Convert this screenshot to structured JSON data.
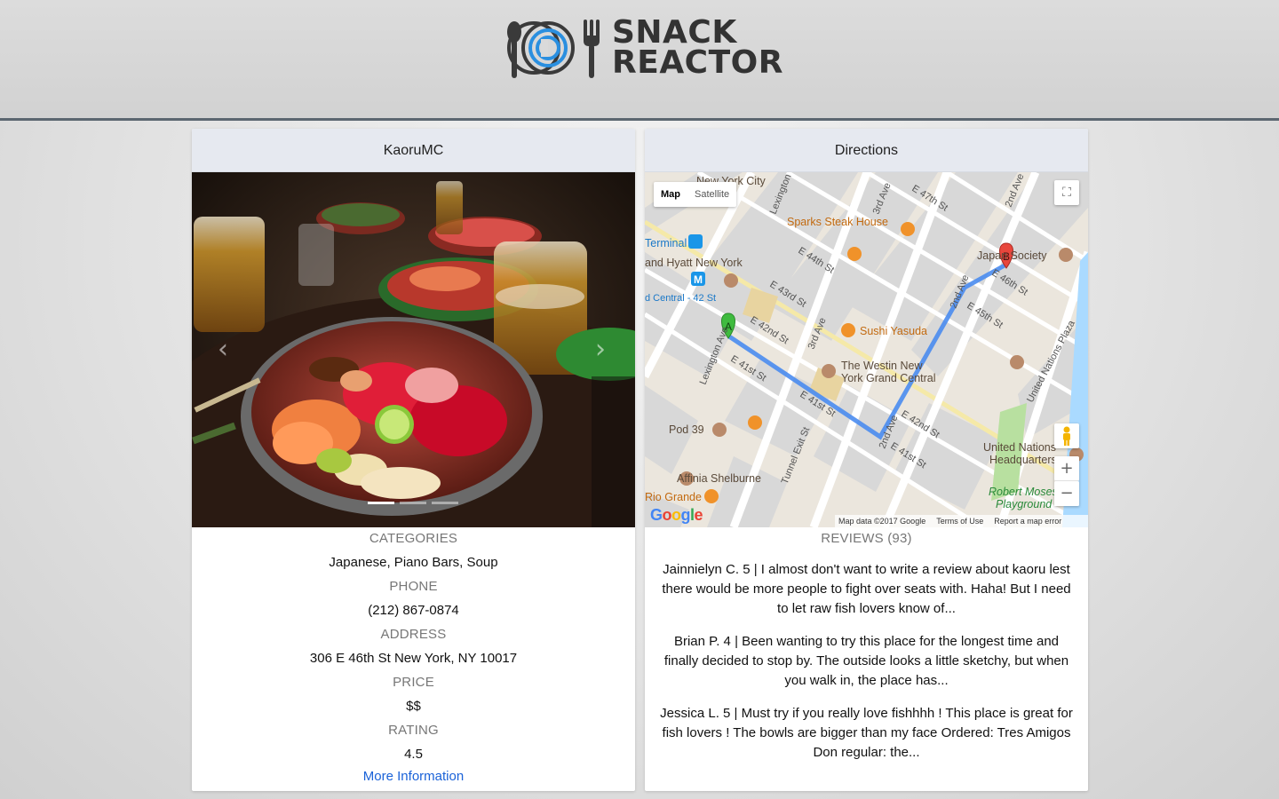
{
  "brand": {
    "line1": "SNACK",
    "line2": "REACTOR",
    "accent_color": "#2a8fe0",
    "icon_color": "#3a3a3a"
  },
  "restaurant": {
    "name": "KaoruMC",
    "categories_label": "CATEGORIES",
    "categories": "Japanese, Piano Bars, Soup",
    "phone_label": "PHONE",
    "phone": "(212) 867-0874",
    "address_label": "ADDRESS",
    "address": "306 E 46th St New York, NY 10017",
    "price_label": "PRICE",
    "price": "$$",
    "rating_label": "RATING",
    "rating": "4.5",
    "more_info": "More Information"
  },
  "carousel": {
    "prev_icon": "chevron-left-icon",
    "next_icon": "chevron-right-icon",
    "slide_count": 3,
    "active_slide": 1
  },
  "directions": {
    "title": "Directions",
    "map_type": {
      "map": "Map",
      "satellite": "Satellite",
      "selected": "Map"
    },
    "google": "Google",
    "footer": {
      "data": "Map data ©2017 Google",
      "terms": "Terms of Use",
      "report": "Report a map error"
    },
    "zoom_in": "+",
    "zoom_out": "−",
    "markers": {
      "a": "A",
      "b": "B"
    },
    "route_color": "#4a8cf0",
    "labels": {
      "nyc": "New York City",
      "lexington": "Lexington",
      "third_ave": "3rd Ave",
      "e47": "E 47th St",
      "sparks": "Sparks Steak House",
      "terminal": "Terminal",
      "hyatt": "and Hyatt New York",
      "e44": "E 44th St",
      "central42": "d Central - 42 St",
      "e43": "E 43rd St",
      "e42a": "E 42nd St",
      "sushi": "Sushi Yasuda",
      "third_ave2": "3rd Ave",
      "lex2": "Lexington Ave",
      "e41a": "E 41st St",
      "westin1": "The Westin New",
      "westin2": "York Grand Central",
      "e41b": "E 41st St",
      "pod39": "Pod 39",
      "tunnel": "Tunnel Exit St",
      "second_ave": "2nd Ave",
      "e41c": "E 41st St",
      "e42b": "E 42nd St",
      "e45": "E 45th St",
      "e46": "E 46th St",
      "japan": "Japan Society",
      "second_ave2": "2nd Ave",
      "second_ave3": "2nd Ave",
      "un_plaza": "United Nations Plaza",
      "un1": "United Nations",
      "un2": "Headquarters",
      "moses1": "Robert Moses",
      "moses2": "Playground",
      "affinia": "Affinia Shelburne",
      "rio": "Rio Grande"
    }
  },
  "reviews": {
    "title": "REVIEWS (93)",
    "items": [
      {
        "text": "Jainnielyn C. 5 | I almost don't want to write a review about kaoru lest there would be more people to fight over seats with. Haha! But I need to let raw fish lovers know of..."
      },
      {
        "text": "Brian P. 4 | Been wanting to try this place for the longest time and finally decided to stop by. The outside looks a little sketchy, but when you walk in, the place has..."
      },
      {
        "text": "Jessica L. 5 | Must try if you really love fishhhh ! This place is great for fish lovers ! The bowls are bigger than my face Ordered: Tres Amigos Don regular: the..."
      }
    ]
  }
}
